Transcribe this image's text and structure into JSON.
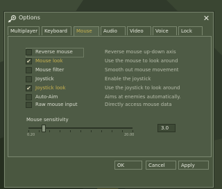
{
  "window": {
    "title": "Options"
  },
  "tabs": [
    "Multiplayer",
    "Keyboard",
    "Mouse",
    "Audio",
    "Video",
    "Voice",
    "Lock"
  ],
  "active_tab": "Mouse",
  "options": [
    {
      "label": "Reverse mouse",
      "description": "Reverse mouse up-down axis",
      "checked": false
    },
    {
      "label": "Mouse look",
      "description": "Use the mouse to look around",
      "checked": true
    },
    {
      "label": "Mouse filter",
      "description": "Smooth out mouse movement",
      "checked": false
    },
    {
      "label": "Joystick",
      "description": "Enable the joystick",
      "checked": false
    },
    {
      "label": "Joystick look",
      "description": "Use the joystick to look around",
      "checked": true
    },
    {
      "label": "Auto-Aim",
      "description": "Aims at enemies automatically.",
      "checked": false
    },
    {
      "label": "Raw mouse input",
      "description": "Directly access mouse data",
      "checked": false
    }
  ],
  "sensitivity": {
    "label": "Mouse sensitivity",
    "value": "3.0",
    "min_label": "0.20",
    "max_label": "20.00",
    "level": 0.14
  },
  "buttons": {
    "ok": "OK",
    "cancel": "Cancel",
    "apply": "Apply"
  },
  "icons": {
    "title_icon": "steam-logo-icon",
    "close": "close-icon",
    "check": "check-icon"
  }
}
